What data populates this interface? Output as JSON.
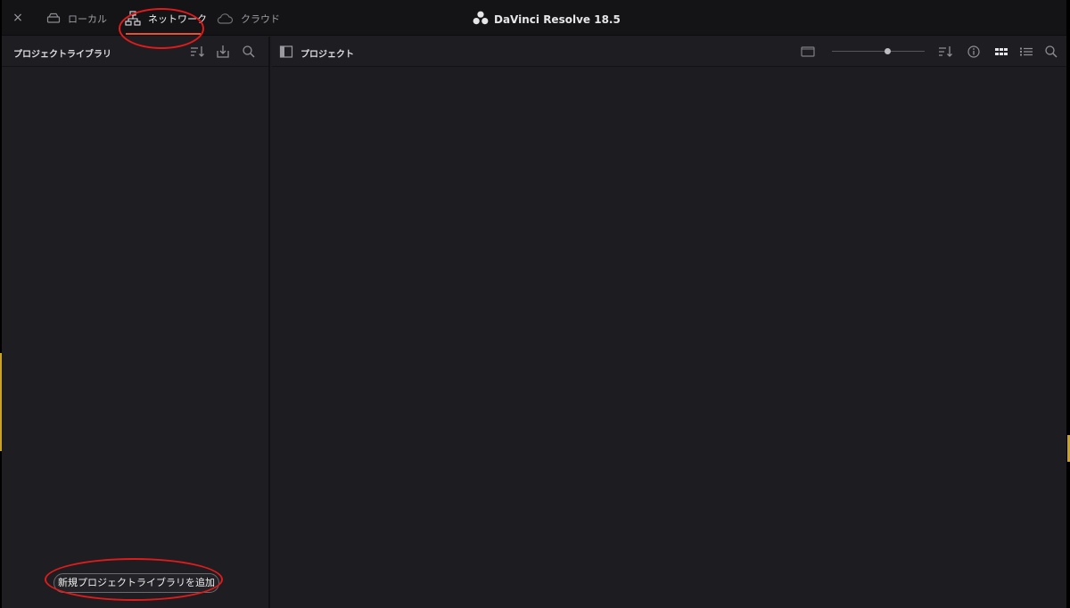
{
  "app": {
    "title": "DaVinci Resolve 18.5"
  },
  "topbar": {
    "close_label": "×",
    "tabs": [
      {
        "label": "ローカル",
        "icon": "drive-icon",
        "active": false
      },
      {
        "label": "ネットワーク",
        "icon": "network-icon",
        "active": true
      },
      {
        "label": "クラウド",
        "icon": "cloud-icon",
        "active": false
      }
    ]
  },
  "left_panel": {
    "title": "プロジェクトライブラリ",
    "add_button_label": "新規プロジェクトライブラリを追加",
    "icons": [
      "sort-icon",
      "import-icon",
      "search-icon"
    ]
  },
  "right_panel": {
    "title": "プロジェクト",
    "zoom_level": 0.6,
    "icons": [
      "panel-toggle-icon",
      "thumbnail-size-icon",
      "sort-icon",
      "info-icon",
      "grid-view-icon",
      "list-view-icon",
      "search-icon"
    ]
  },
  "colors": {
    "accent": "#e8512c",
    "annotation": "#e01b1b",
    "background": "#1d1d21"
  }
}
